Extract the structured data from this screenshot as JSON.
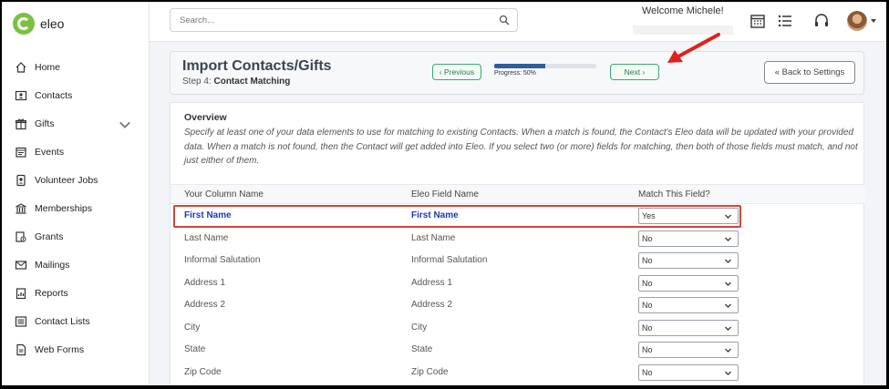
{
  "app": {
    "brand": "eleo"
  },
  "sidebar": {
    "items": [
      {
        "label": "Home",
        "icon": "home-icon"
      },
      {
        "label": "Contacts",
        "icon": "contacts-icon"
      },
      {
        "label": "Gifts",
        "icon": "gift-icon"
      },
      {
        "label": "Events",
        "icon": "calendar-icon"
      },
      {
        "label": "Volunteer Jobs",
        "icon": "badge-icon"
      },
      {
        "label": "Memberships",
        "icon": "building-icon"
      },
      {
        "label": "Grants",
        "icon": "grant-icon"
      },
      {
        "label": "Mailings",
        "icon": "mail-icon"
      },
      {
        "label": "Reports",
        "icon": "report-icon"
      },
      {
        "label": "Contact Lists",
        "icon": "list-icon"
      },
      {
        "label": "Web Forms",
        "icon": "form-icon"
      }
    ]
  },
  "topbar": {
    "search_placeholder": "Search...",
    "welcome": "Welcome Michele!"
  },
  "header": {
    "title": "Import Contacts/Gifts",
    "step_prefix": "Step 4:",
    "step_name": "Contact Matching",
    "prev_label": "‹ Previous",
    "next_label": "Next ›",
    "progress_label": "Progress: 50%",
    "progress": 0.5,
    "back_label": "« Back to Settings"
  },
  "overview": {
    "title": "Overview",
    "text": "Specify at least one of your data elements to use for matching to existing Contacts. When a match is found, the Contact's Eleo data will be updated with your provided data. When a match is not found, then the Contact will get added into Eleo. If you select two (or more) fields for matching, then both of those fields must match, and not just either of them."
  },
  "table": {
    "headers": [
      "Your Column Name",
      "Eleo Field Name",
      "Match This Field?"
    ],
    "rows": [
      {
        "column": "First Name",
        "field": "First Name",
        "match": "Yes"
      },
      {
        "column": "Last Name",
        "field": "Last Name",
        "match": "No"
      },
      {
        "column": "Informal Salutation",
        "field": "Informal Salutation",
        "match": "No"
      },
      {
        "column": "Address 1",
        "field": "Address 1",
        "match": "No"
      },
      {
        "column": "Address 2",
        "field": "Address 2",
        "match": "No"
      },
      {
        "column": "City",
        "field": "City",
        "match": "No"
      },
      {
        "column": "State",
        "field": "State",
        "match": "No"
      },
      {
        "column": "Zip Code",
        "field": "Zip Code",
        "match": "No"
      }
    ]
  },
  "colors": {
    "brand_green": "#7ac143",
    "step_button": "#3aaa6e",
    "progress_fill": "#2f5e9e",
    "highlight": "#d9423a",
    "matched_text": "#1a3bb8"
  }
}
